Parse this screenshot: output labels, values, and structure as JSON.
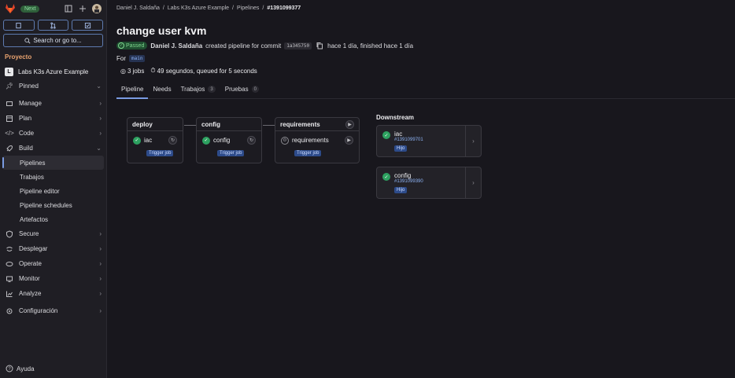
{
  "sidebar": {
    "next_badge": "Next",
    "search_label": "Search or go to...",
    "section": "Proyecto",
    "project_letter": "L",
    "project_name": "Labs K3s Azure Example",
    "items": [
      {
        "label": "Pinned",
        "icon": "pin-icon"
      },
      {
        "label": "Manage",
        "icon": "manage-icon"
      },
      {
        "label": "Plan",
        "icon": "plan-icon"
      },
      {
        "label": "Code",
        "icon": "code-icon"
      },
      {
        "label": "Build",
        "icon": "rocket-icon"
      },
      {
        "label": "Secure",
        "icon": "shield-icon"
      },
      {
        "label": "Desplegar",
        "icon": "deploy-icon"
      },
      {
        "label": "Operate",
        "icon": "operate-icon"
      },
      {
        "label": "Monitor",
        "icon": "monitor-icon"
      },
      {
        "label": "Analyze",
        "icon": "chart-icon"
      },
      {
        "label": "Configuración",
        "icon": "gear-icon"
      }
    ],
    "build_sub": [
      "Pipelines",
      "Trabajos",
      "Pipeline editor",
      "Pipeline schedules",
      "Artefactos"
    ],
    "help": "Ayuda"
  },
  "breadcrumb": [
    "Daniel J. Saldaña",
    "Labs K3s Azure Example",
    "Pipelines",
    "#1391099377"
  ],
  "page": {
    "title": "change user kvm",
    "status": "Passed",
    "author": "Daniel J. Saldaña",
    "created_text": "created pipeline for commit",
    "commit": "1a345750",
    "time_text": "hace 1 día, finished hace 1 día",
    "for_label": "For",
    "branch": "main",
    "jobs": "3 jobs",
    "duration": "49 segundos, queued for 5 seconds"
  },
  "tabs": [
    {
      "label": "Pipeline",
      "count": ""
    },
    {
      "label": "Needs",
      "count": ""
    },
    {
      "label": "Trabajos",
      "count": "3"
    },
    {
      "label": "Pruebas",
      "count": "0"
    }
  ],
  "stages": [
    {
      "name": "deploy",
      "job": "iac",
      "trigger": "Trigger job"
    },
    {
      "name": "config",
      "job": "config",
      "trigger": "Trigger job"
    },
    {
      "name": "requirements",
      "job": "requirements",
      "trigger": "Trigger job"
    }
  ],
  "downstream": {
    "title": "Downstream",
    "items": [
      {
        "name": "iac",
        "id": "#1391099701",
        "tag": "Hijo"
      },
      {
        "name": "config",
        "id": "#1391099390",
        "tag": "Hijo"
      }
    ]
  },
  "colors": {
    "accent": "#7a9be2",
    "success": "#2da160",
    "section": "#e9a36f"
  }
}
